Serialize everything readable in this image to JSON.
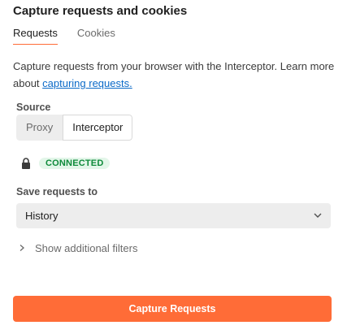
{
  "panel": {
    "title": "Capture requests and cookies"
  },
  "tabs": [
    {
      "label": "Requests",
      "active": true
    },
    {
      "label": "Cookies",
      "active": false
    }
  ],
  "description": {
    "text": "Capture requests from your browser with the Interceptor. Learn more about ",
    "link_text": "capturing requests."
  },
  "source": {
    "label": "Source",
    "options": [
      {
        "label": "Proxy",
        "selected": false
      },
      {
        "label": "Interceptor",
        "selected": true
      }
    ]
  },
  "status": {
    "icon": "lock-icon",
    "badge": "CONNECTED",
    "badge_color": "#0e8a3a"
  },
  "save_to": {
    "label": "Save requests to",
    "value": "History"
  },
  "filters": {
    "label": "Show additional filters"
  },
  "capture_button": {
    "label": "Capture Requests",
    "color": "#ff6c37"
  }
}
